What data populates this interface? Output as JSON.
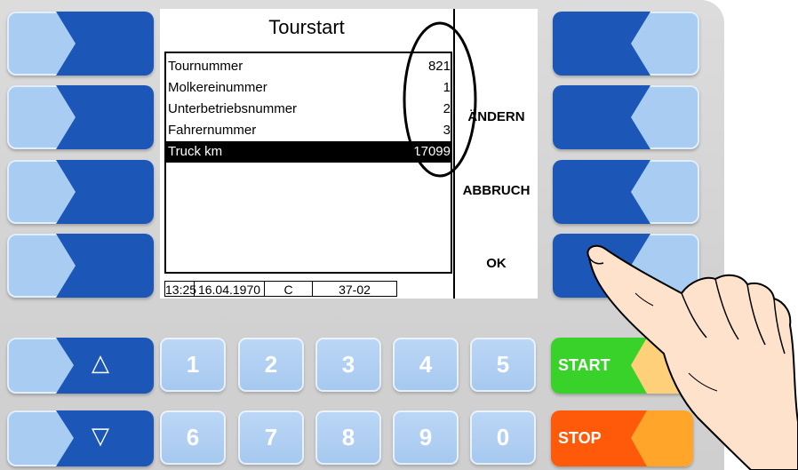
{
  "screen": {
    "title": "Tourstart",
    "rows": [
      {
        "label": "Tournummer",
        "value": "821"
      },
      {
        "label": "Molkereinummer",
        "value": "1"
      },
      {
        "label": "Unterbetriebsnummer",
        "value": "2"
      },
      {
        "label": "Fahrernummer",
        "value": "3"
      },
      {
        "label": "Truck km",
        "value": "17099"
      }
    ],
    "status": {
      "time": "13:25",
      "date": "16.04.1970",
      "mode": "C",
      "code": "37-02"
    },
    "softkeys": {
      "change": "ÄNDERN",
      "cancel": "ABBRUCH",
      "ok": "OK"
    }
  },
  "keypad": {
    "up_symbol": "△",
    "down_symbol": "▽",
    "digits_row1": [
      "1",
      "2",
      "3",
      "4",
      "5"
    ],
    "digits_row2": [
      "6",
      "7",
      "8",
      "9",
      "0"
    ],
    "start_label": "START",
    "stop_label": "STOP"
  },
  "colors": {
    "key_dark": "#1c57b8",
    "key_light": "#a9cdf2",
    "start_green": "#39d22a",
    "stop_orange": "#ff5a0a"
  }
}
